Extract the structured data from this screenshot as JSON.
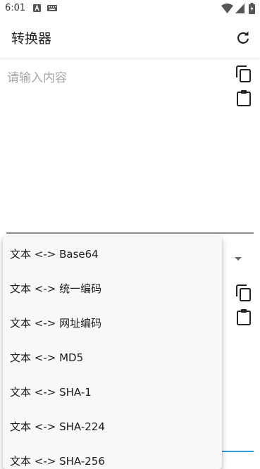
{
  "status_bar": {
    "time": "6:01"
  },
  "app_bar": {
    "title": "转换器"
  },
  "input": {
    "value": "",
    "placeholder": "请输入内容"
  },
  "menu": {
    "items": [
      {
        "label": "文本 <-> Base64"
      },
      {
        "label": "文本 <-> 统一编码"
      },
      {
        "label": "文本 <-> 网址编码"
      },
      {
        "label": "文本 <-> MD5"
      },
      {
        "label": "文本 <-> SHA-1"
      },
      {
        "label": "文本 <-> SHA-224"
      },
      {
        "label": "文本 <-> SHA-256"
      }
    ]
  },
  "colors": {
    "accent": "#2aa0e0",
    "underline": "#8a8a8a",
    "menu_background": "#f8f8f8"
  },
  "icons": {
    "copy": "copy-icon",
    "paste": "clipboard-icon",
    "refresh": "refresh-icon",
    "dropdown": "dropdown-arrow-icon"
  }
}
